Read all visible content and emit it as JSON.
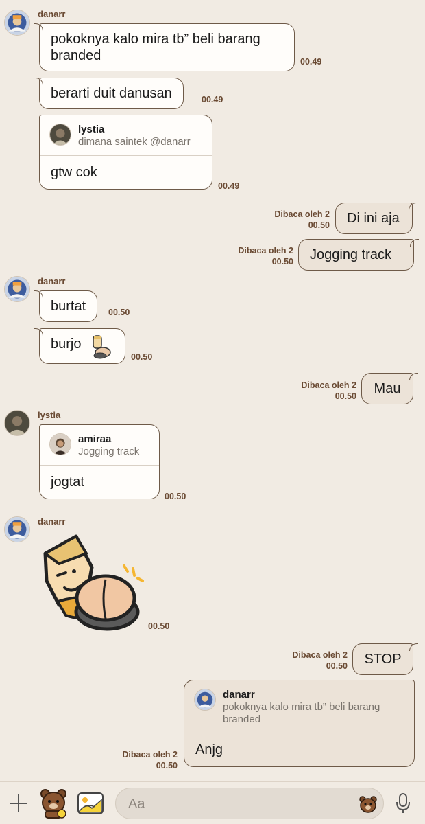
{
  "messages": {
    "m1": {
      "sender": "danarr",
      "text": "pokoknya kalo mira tb” beli barang branded",
      "time": "00.49"
    },
    "m2": {
      "text": "berarti duit danusan",
      "time": "00.49"
    },
    "m3": {
      "quote_name": "lystia",
      "quote_text": "dimana saintek @danarr",
      "text": "gtw cok",
      "time": "00.49"
    },
    "m4": {
      "read": "Dibaca oleh 2",
      "time": "00.50",
      "text": "Di ini aja"
    },
    "m5": {
      "read": "Dibaca oleh 2",
      "time": "00.50",
      "text": "Jogging track"
    },
    "m6": {
      "sender": "danarr",
      "text": "burtat",
      "time": "00.50"
    },
    "m7": {
      "text": "burjo",
      "time": "00.50",
      "emoji_icon": "sitting-character-emoji-icon"
    },
    "m8": {
      "read": "Dibaca oleh 2",
      "time": "00.50",
      "text": "Mau"
    },
    "m9": {
      "sender": "lystia",
      "quote_name": "amiraa",
      "quote_text": "Jogging track",
      "text": "jogtat",
      "time": "00.50"
    },
    "m10": {
      "sender": "danarr",
      "sticker_icon": "butt-character-sticker-icon",
      "time": "00.50"
    },
    "m11": {
      "read": "Dibaca oleh 2",
      "time": "00.50",
      "text": "STOP"
    },
    "m12": {
      "read": "Dibaca oleh 2",
      "time": "00.50",
      "quote_name": "danarr",
      "quote_text": "pokoknya kalo mira tb” beli barang branded",
      "text": "Anjg"
    }
  },
  "composer": {
    "placeholder": "Aa"
  },
  "colors": {
    "background": "#f1ebe3",
    "bubble_border": "#6e5a48",
    "meta_text": "#6a4a33"
  }
}
